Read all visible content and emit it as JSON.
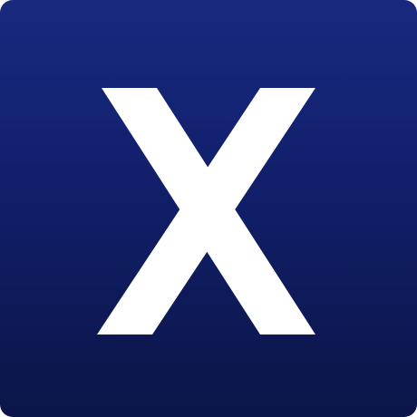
{
  "icon": {
    "name": "x-letter-icon",
    "letter": "X",
    "background_top": "#18297f",
    "background_bottom": "#0b1548",
    "glyph_color": "#ffffff"
  }
}
